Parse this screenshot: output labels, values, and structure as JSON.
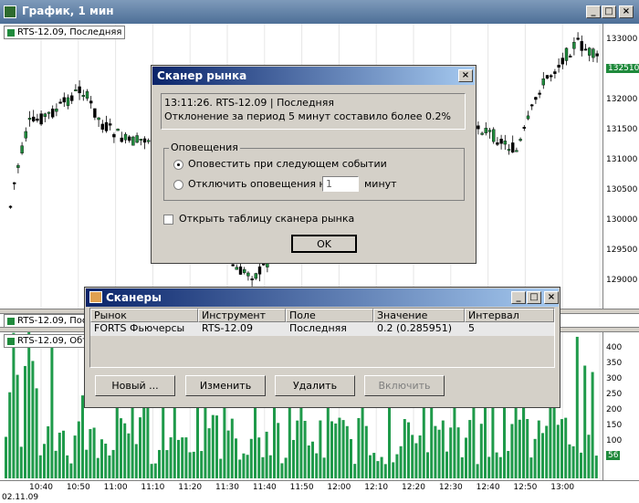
{
  "main_window": {
    "title": "График, 1 мин"
  },
  "price_panel": {
    "label": "RTS-12.09, Последняя",
    "y_labels": [
      "133000",
      "132500",
      "132000",
      "131500",
      "131000",
      "130500",
      "130000",
      "129500",
      "129000"
    ],
    "price_badge": "132510"
  },
  "volume_panel": {
    "label": "RTS-12.09, Объем",
    "y_labels": [
      "400",
      "350",
      "300",
      "250",
      "200",
      "150",
      "100",
      "50"
    ],
    "volume_badge": "56"
  },
  "collapsed_panel": {
    "label": "RTS-12.09, Последняя"
  },
  "x_axis": {
    "labels": [
      "10:40",
      "10:50",
      "11:00",
      "11:10",
      "11:20",
      "11:30",
      "11:40",
      "11:50",
      "12:00",
      "12:10",
      "12:20",
      "12:30",
      "12:40",
      "12:50",
      "13:00"
    ],
    "date_label": "02.11.09"
  },
  "alert_dialog": {
    "title": "Сканер рынка",
    "message_line1": "13:11:26. RTS-12.09 | Последняя",
    "message_line2": "Отклонение за период 5 минут составило более 0.2%",
    "group_title": "Оповещения",
    "radio_notify": "Оповестить при следующем событии",
    "radio_disable_prefix": "Отключить оповещения на",
    "radio_disable_value": "1",
    "radio_disable_suffix": "минут",
    "checkbox_open_table": "Открыть таблицу сканера рынка",
    "ok_label": "OK"
  },
  "scanners_window": {
    "title": "Сканеры",
    "columns": [
      "Рынок",
      "Инструмент",
      "Поле",
      "Значение",
      "Интервал"
    ],
    "rows": [
      {
        "market": "FORTS Фьючерсы",
        "instrument": "RTS-12.09",
        "field": "Последняя",
        "value": "0.2 (0.285951)",
        "interval": "5"
      }
    ],
    "buttons": {
      "new": "Новый ...",
      "edit": "Изменить",
      "delete": "Удалить",
      "enable": "Включить"
    }
  },
  "colors": {
    "candle_up": "#1f8a3c",
    "candle_down": "#000000",
    "volume_bar": "#1f9a4a",
    "title_bar": "#0a246a"
  }
}
